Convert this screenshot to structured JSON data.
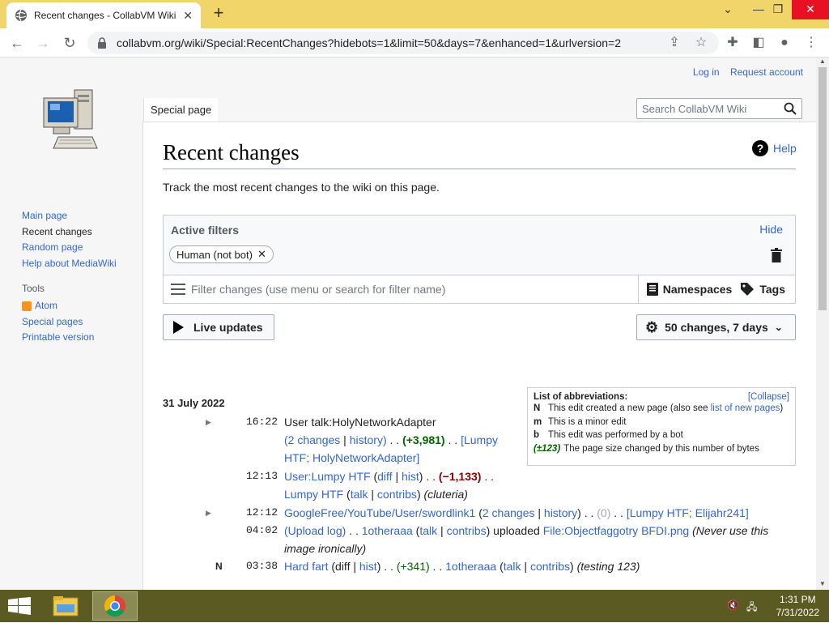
{
  "browser": {
    "tab_title": "Recent changes - CollabVM Wiki",
    "url": "collabvm.org/wiki/Special:RecentChanges?hidebots=1&limit=50&days=7&enhanced=1&urlversion=2"
  },
  "header": {
    "login": "Log in",
    "request_account": "Request account",
    "special_tab": "Special page",
    "search_placeholder": "Search CollabVM Wiki"
  },
  "sidebar": {
    "nav": [
      "Main page",
      "Recent changes",
      "Random page",
      "Help about MediaWiki"
    ],
    "tools_heading": "Tools",
    "tools": [
      "Atom",
      "Special pages",
      "Printable version"
    ]
  },
  "main": {
    "title": "Recent changes",
    "help": "Help",
    "lead": "Track the most recent changes to the wiki on this page.",
    "filters": {
      "heading": "Active filters",
      "hide": "Hide",
      "chip": "Human (not bot)",
      "placeholder": "Filter changes (use menu or search for filter name)",
      "namespaces": "Namespaces",
      "tags": "Tags"
    },
    "live_updates": "Live updates",
    "limit": "50 changes, 7 days"
  },
  "legend": {
    "heading": "List of abbreviations:",
    "collapse": "[Collapse]",
    "rows": [
      {
        "key": "N",
        "text": "This edit created a new page (also see ",
        "link": "list of new pages",
        "after": ")"
      },
      {
        "key": "m",
        "text": "This is a minor edit"
      },
      {
        "key": "b",
        "text": "This edit was performed by a bot"
      },
      {
        "key": "(±123)",
        "text": "The page size changed by this number of bytes"
      }
    ]
  },
  "changes": {
    "day": "31 July 2022",
    "entries": {
      "e1": {
        "time": "16:22",
        "page": "User talk:HolyNetworkAdapter",
        "changes": "2 changes",
        "history": "history",
        "diff": "(+3,981)",
        "users": "Lumpy HTF; HolyNetworkAdapter"
      },
      "e2": {
        "time": "12:13",
        "page": "User:Lumpy HTF",
        "diff_l": "diff",
        "hist_l": "hist",
        "diff": "(−1,133)",
        "user": "Lumpy HTF",
        "talk": "talk",
        "contribs": "contribs",
        "summary": "(cluteria)"
      },
      "e3": {
        "time": "12:12",
        "page": "GoogleFree/YouTube/User/swordlink1",
        "changes": "2 changes",
        "history": "history",
        "diff": "(0)",
        "users": "Lumpy HTF; Elijahr241"
      },
      "e4": {
        "time": "04:02",
        "log": "Upload log",
        "user": "1otheraaa",
        "talk": "talk",
        "contribs": "contribs",
        "action": "uploaded",
        "file": "File:Objectfaggotry BFDI.png",
        "summary": "(Never use this image ironically)"
      },
      "e5": {
        "flag": "N",
        "time": "03:38",
        "page": "Hard fart",
        "diff_l": "diff",
        "hist_l": "hist",
        "diff": "(+341)",
        "user": "1otheraaa",
        "talk": "talk",
        "contribs": "contribs",
        "summary": "(testing 123)"
      }
    }
  },
  "taskbar": {
    "time": "1:31 PM",
    "date": "7/31/2022"
  }
}
